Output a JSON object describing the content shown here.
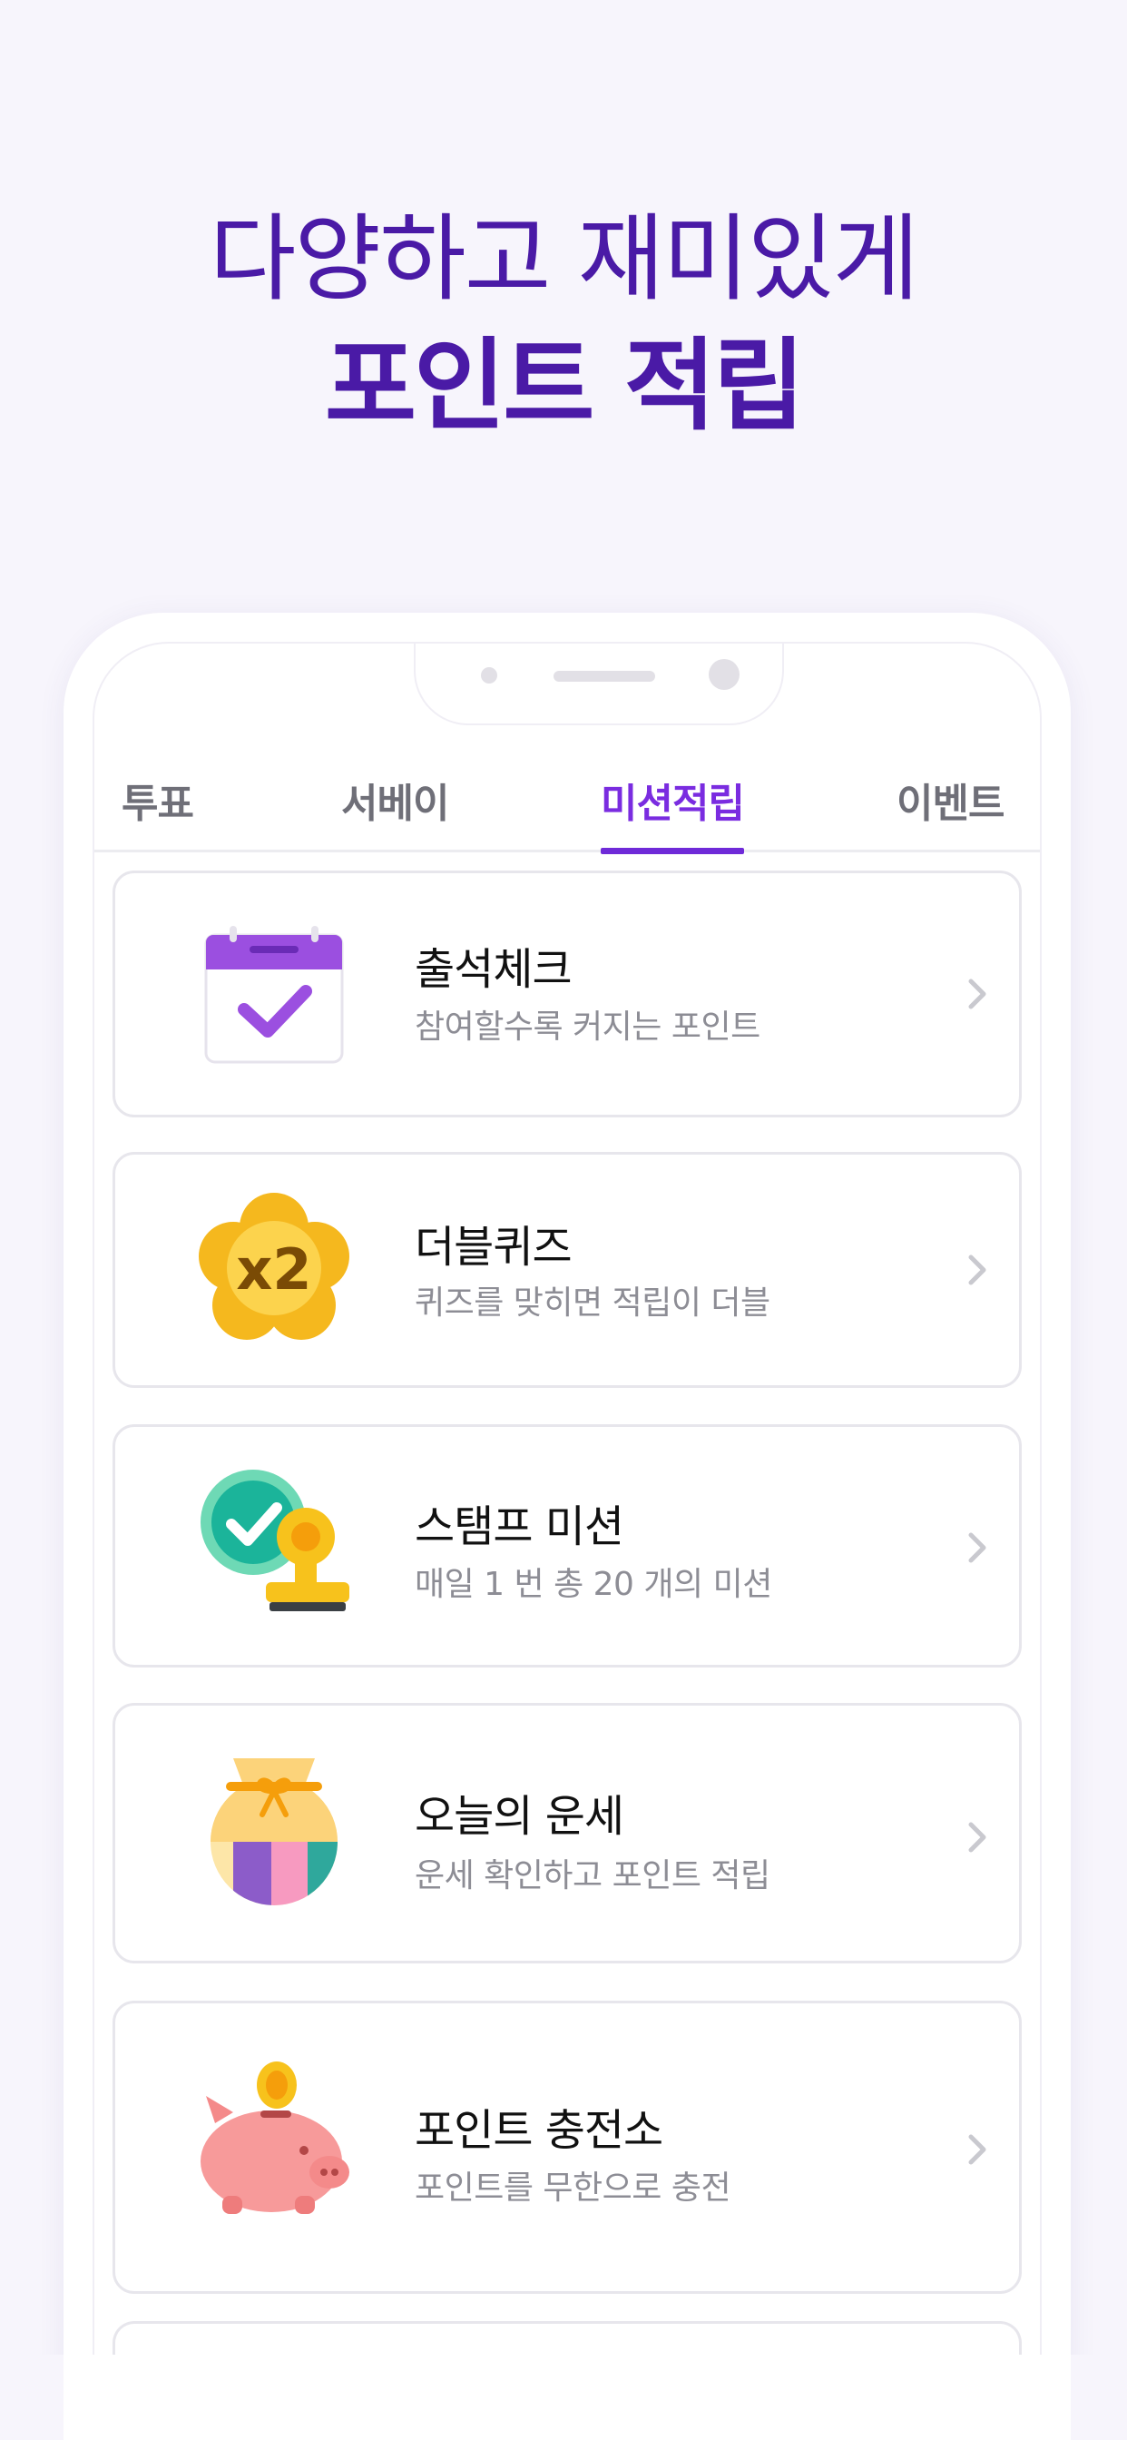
{
  "headline": {
    "line1": "다양하고 재미있게",
    "line2": "포인트 적립"
  },
  "tabs": [
    {
      "label": "투표",
      "active": false
    },
    {
      "label": "서베이",
      "active": false
    },
    {
      "label": "미션적립",
      "active": true
    },
    {
      "label": "이벤트",
      "active": false
    }
  ],
  "missions": [
    {
      "title": "출석체크",
      "subtitle": "참여할수록 커지는 포인트",
      "icon": "calendar-check-icon"
    },
    {
      "title": "더블퀴즈",
      "subtitle": "퀴즈를 맞히면 적립이 더블",
      "icon": "x2-badge-icon",
      "badge_text": "x2"
    },
    {
      "title": "스탬프 미션",
      "subtitle": "매일 1 번 총 20 개의 미션",
      "icon": "stamp-icon"
    },
    {
      "title": "오늘의 운세",
      "subtitle": "운세 확인하고 포인트 적립",
      "icon": "fortune-pouch-icon"
    },
    {
      "title": "포인트 충전소",
      "subtitle": "포인트를 무한으로 충전",
      "icon": "piggy-bank-icon"
    }
  ],
  "colors": {
    "accent": "#6f2ad8",
    "headline": "#4a1aa6",
    "background": "#f7f5fc"
  }
}
